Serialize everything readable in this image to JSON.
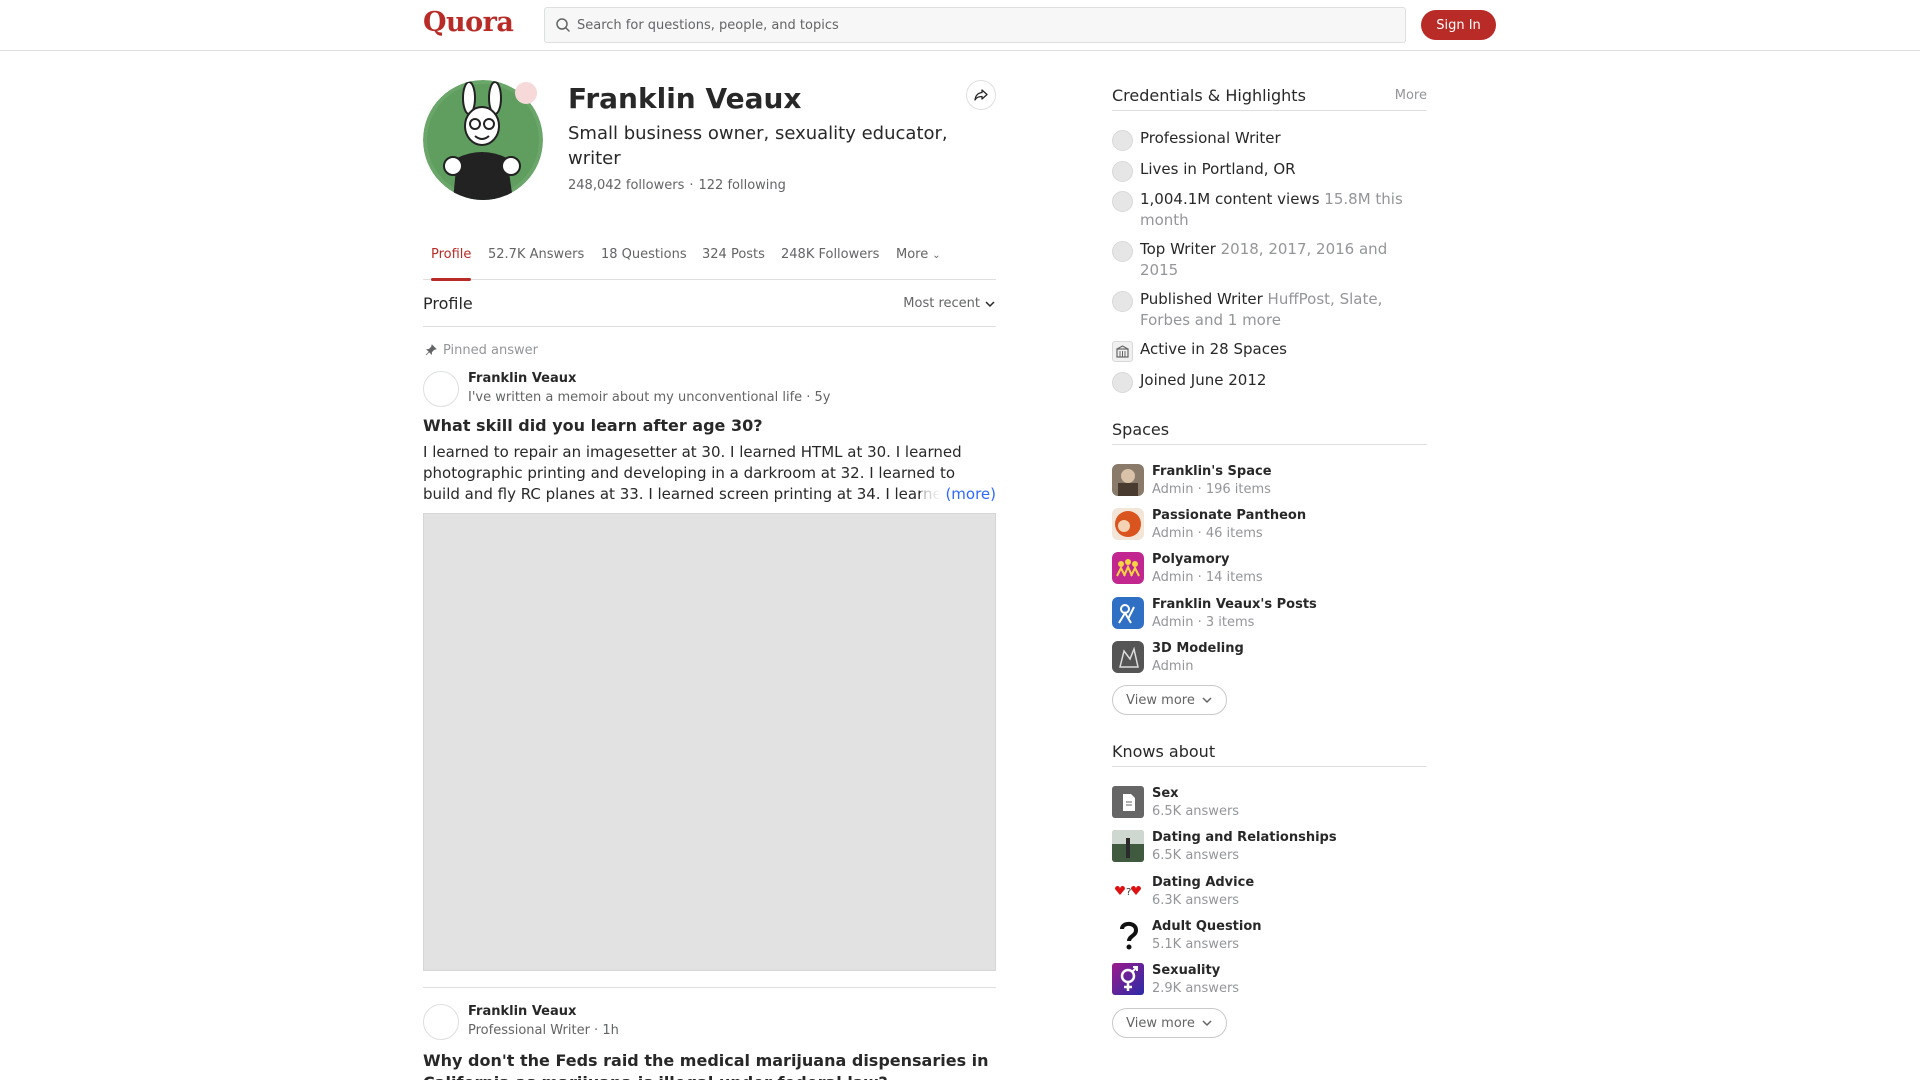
{
  "header": {
    "logo": "Quora",
    "search_placeholder": "Search for questions, people, and topics",
    "signin_label": "Sign In"
  },
  "profile": {
    "name": "Franklin Veaux",
    "tagline": "Small business owner, sexuality educator, writer",
    "followers": "248,042 followers",
    "following": "122 following",
    "separator": "·"
  },
  "tabs": [
    {
      "label": "Profile"
    },
    {
      "label": "52.7K Answers"
    },
    {
      "label": "18 Questions"
    },
    {
      "label": "324 Posts"
    },
    {
      "label": "248K Followers"
    },
    {
      "label": "More"
    }
  ],
  "section": {
    "title": "Profile",
    "sort_label": "Most recent"
  },
  "posts": [
    {
      "pinned_label": "Pinned answer",
      "author": "Franklin Veaux",
      "meta": "I've written a memoir about my unconventional life · 5y",
      "question": "What skill did you learn after age 30?",
      "body": "I learned to repair an imagesetter at 30. I learned HTML at 30. I learned photographic printing and developing in a darkroom at 32. I learned to build and fly RC planes at 33. I learned screen printing at 34. I learned",
      "more_label": "(more)"
    },
    {
      "author": "Franklin Veaux",
      "meta": "Professional Writer · 1h",
      "question": "Why don't the Feds raid the medical marijuana dispensaries in California as marijuana is illegal under federal law?"
    }
  ],
  "credentials": {
    "title": "Credentials & Highlights",
    "more_label": "More",
    "items": [
      {
        "main": "Professional Writer",
        "dim": ""
      },
      {
        "main": "Lives in Portland, OR",
        "dim": ""
      },
      {
        "main": "1,004.1M content views",
        "dim": " 15.8M this month"
      },
      {
        "main": "Top Writer",
        "dim": " 2018, 2017, 2016 and 2015"
      },
      {
        "main": "Published Writer",
        "dim": " HuffPost, Slate, Forbes and 1 more"
      },
      {
        "main": "Active in 28 Spaces",
        "dim": ""
      },
      {
        "main": "Joined June 2012",
        "dim": ""
      }
    ]
  },
  "spaces": {
    "title": "Spaces",
    "items": [
      {
        "name": "Franklin's Space",
        "meta": "Admin · 196 items"
      },
      {
        "name": "Passionate Pantheon",
        "meta": "Admin · 46 items"
      },
      {
        "name": "Polyamory",
        "meta": "Admin · 14 items"
      },
      {
        "name": "Franklin Veaux's Posts",
        "meta": "Admin · 3 items"
      },
      {
        "name": "3D Modeling",
        "meta": "Admin"
      }
    ],
    "view_more": "View more"
  },
  "knows_about": {
    "title": "Knows about",
    "items": [
      {
        "name": "Sex",
        "meta": "6.5K answers"
      },
      {
        "name": "Dating and Relationships",
        "meta": "6.5K answers"
      },
      {
        "name": "Dating Advice",
        "meta": "6.3K answers"
      },
      {
        "name": "Adult Question",
        "meta": "5.1K answers"
      },
      {
        "name": "Sexuality",
        "meta": "2.9K answers"
      }
    ],
    "view_more": "View more"
  },
  "colors": {
    "brand": "#b92b27",
    "link": "#2e69ff"
  }
}
